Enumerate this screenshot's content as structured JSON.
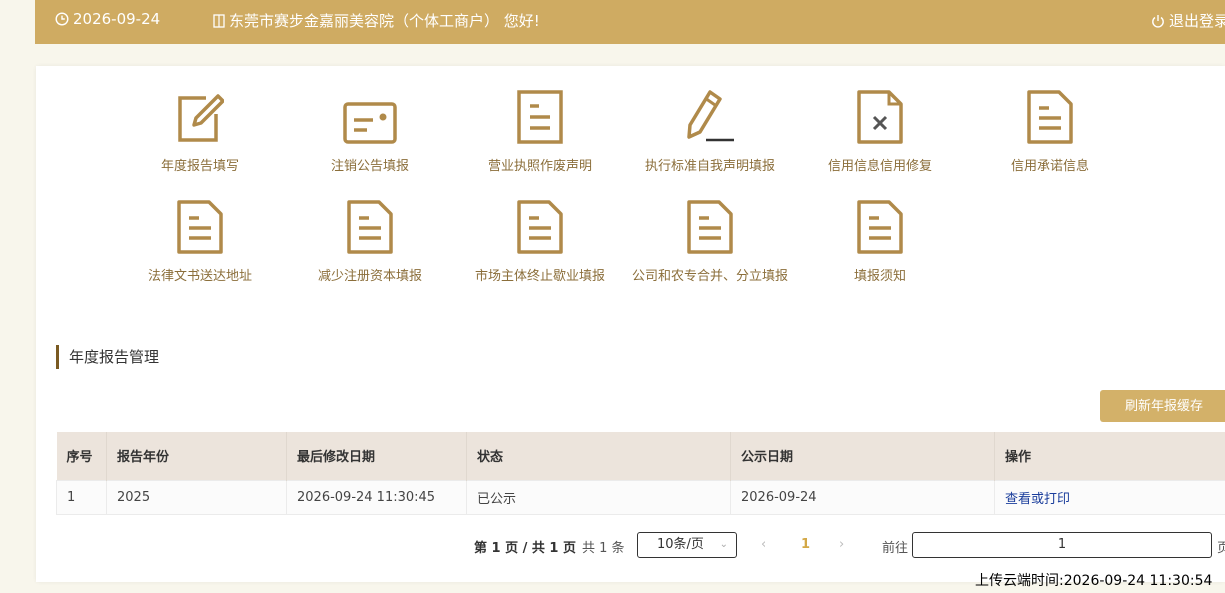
{
  "header": {
    "date": "2026-09-24",
    "greeting": "东莞市赛步金嘉丽美容院（个体工商户） 您好!",
    "logout": "退出登录"
  },
  "colors": {
    "header_bg": "#cfab62",
    "icon": "#b08a4a",
    "accent": "#d3b169"
  },
  "menu": [
    {
      "label": "年度报告填写",
      "icon": "edit-icon"
    },
    {
      "label": "注销公告填报",
      "icon": "card-icon"
    },
    {
      "label": "营业执照作废声明",
      "icon": "document-icon"
    },
    {
      "label": "执行标准自我声明填报",
      "icon": "pencil-icon"
    },
    {
      "label": "信用信息信用修复",
      "icon": "document-x-icon"
    },
    {
      "label": "信用承诺信息",
      "icon": "document-icon"
    },
    {
      "label": "法律文书送达地址",
      "icon": "document-icon"
    },
    {
      "label": "减少注册资本填报",
      "icon": "document-icon"
    },
    {
      "label": "市场主体终止歇业填报",
      "icon": "document-icon"
    },
    {
      "label": "公司和农专合并、分立填报",
      "icon": "document-icon"
    },
    {
      "label": "填报须知",
      "icon": "document-icon"
    }
  ],
  "section": {
    "title": "年度报告管理",
    "refresh_btn": "刷新年报缓存"
  },
  "table": {
    "headers": [
      "序号",
      "报告年份",
      "最后修改日期",
      "状态",
      "公示日期",
      "操作"
    ],
    "rows": [
      {
        "no": "1",
        "year": "2025",
        "modified": "2026-09-24 11:30:45",
        "status": "已公示",
        "pub_date": "2026-09-24",
        "action": "查看或打印"
      }
    ]
  },
  "pagination": {
    "info": "第 1 页 / 共 1 页",
    "total": "共 1 条",
    "page_size": "10条/页",
    "prev": "‹",
    "current": "1",
    "next": "›",
    "goto": "前往",
    "goto_value": "1",
    "unit": "页"
  },
  "upload_time": "上传云端时间:2026-09-24 11:30:54"
}
